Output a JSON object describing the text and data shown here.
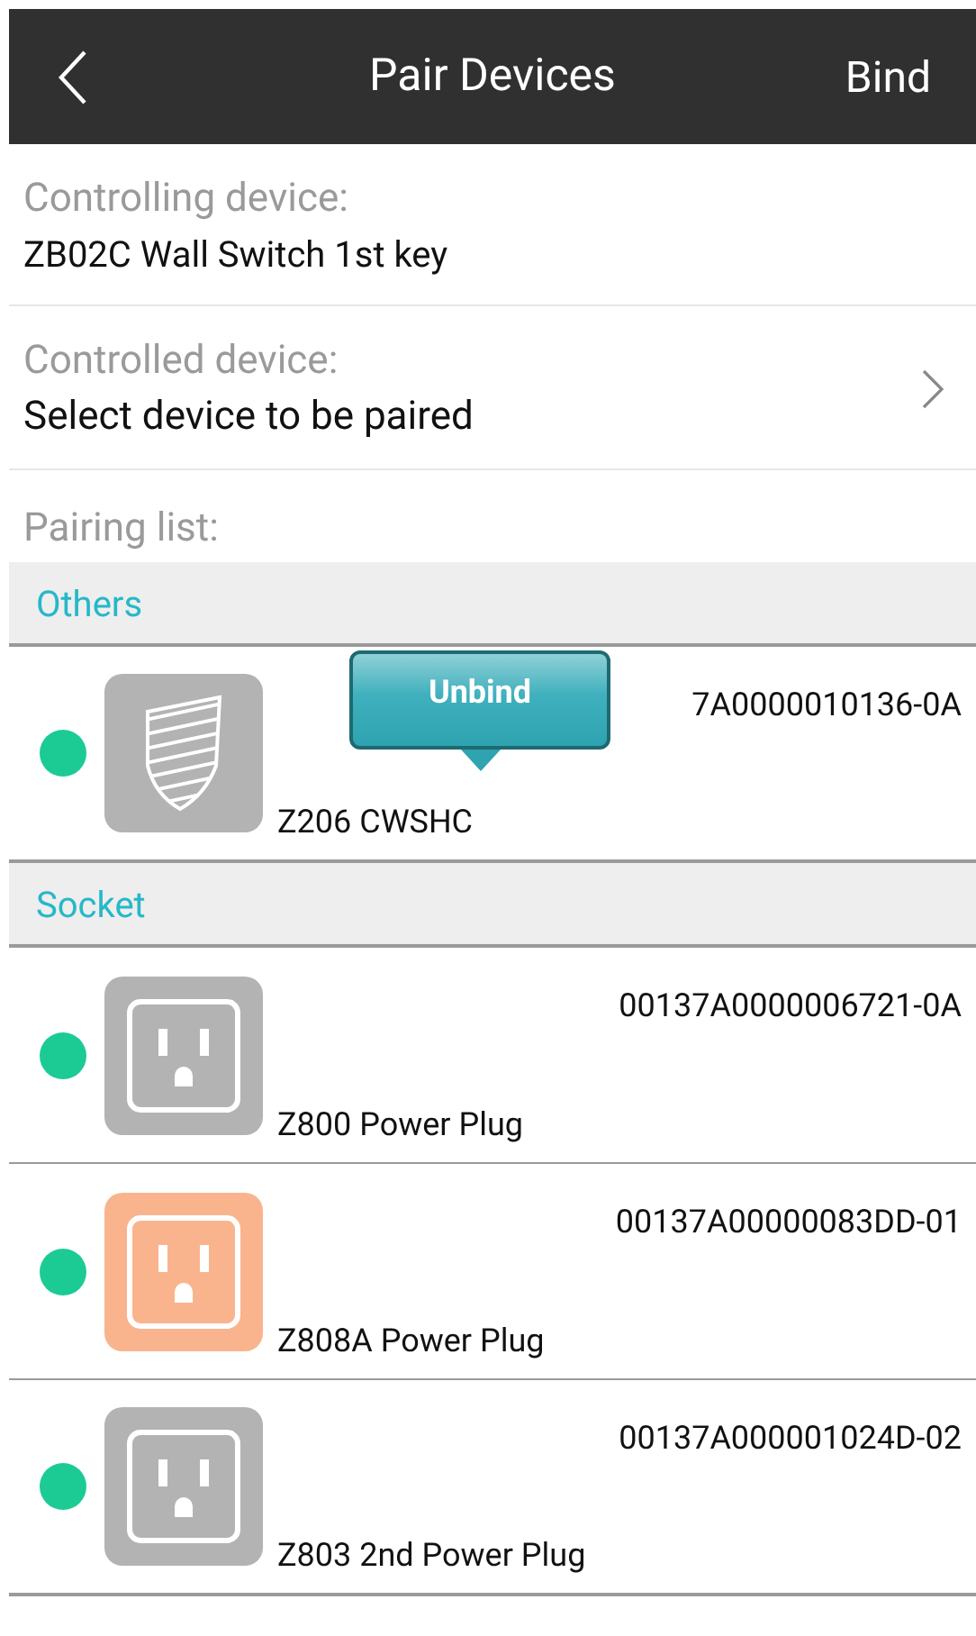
{
  "header": {
    "title": "Pair Devices",
    "action": "Bind"
  },
  "controlling": {
    "label": "Controlling device:",
    "value": "ZB02C Wall Switch 1st key"
  },
  "controlled": {
    "label": "Controlled device:",
    "value": "Select device to be paired"
  },
  "pairing_list": {
    "label": "Pairing list:",
    "groups": [
      {
        "name": "Others",
        "devices": [
          {
            "kind": "shield",
            "color": "#b3b3b3",
            "online": true,
            "name": "Z206 CWSHC",
            "id": "7A0000010136-0A",
            "tooltip": "Unbind"
          }
        ]
      },
      {
        "name": "Socket",
        "devices": [
          {
            "kind": "socket",
            "color": "#b3b3b3",
            "online": true,
            "name": "Z800 Power Plug",
            "id": "00137A0000006721-0A"
          },
          {
            "kind": "socket",
            "color": "#f9b48e",
            "online": true,
            "name": "Z808A Power Plug",
            "id": "00137A00000083DD-01"
          },
          {
            "kind": "socket",
            "color": "#b3b3b3",
            "online": true,
            "name": "Z803 2nd Power Plug",
            "id": "00137A000001024D-02"
          }
        ]
      }
    ]
  }
}
